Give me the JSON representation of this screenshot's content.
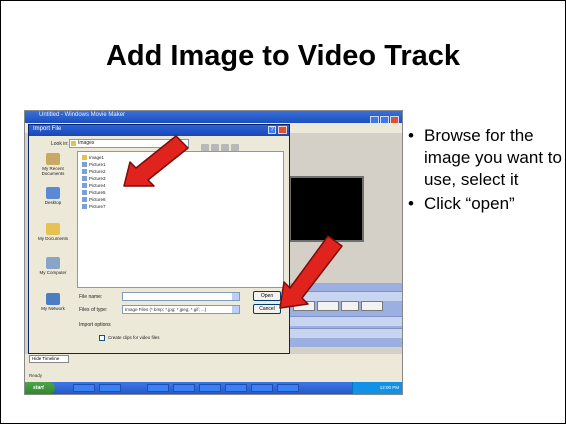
{
  "slide": {
    "title": "Add Image to Video Track",
    "bullets": [
      "Browse for the image you want to use, select it",
      "Click “open”"
    ],
    "bullet_char": "•",
    "arrow_color": "#e0231c"
  },
  "screenshot": {
    "window_title": "Untitled - Windows Movie Maker",
    "dialog": {
      "title": "Import File",
      "help_label": "?",
      "look_in_label": "Look in:",
      "look_in_value": "Images",
      "places": [
        "My Recent Documents",
        "Desktop",
        "My Documents",
        "My Computer",
        "My Network"
      ],
      "files": [
        "Image1",
        "Picture1",
        "Picture2",
        "Picture3",
        "Picture4",
        "Picture5",
        "Picture6",
        "Picture7"
      ],
      "file_name_label": "File name:",
      "file_name_value": "",
      "file_type_label": "Files of type:",
      "file_type_value": "Image Files (*.bmp; *.jpg; *.jpeg; *.gif; ...)",
      "open_label": "Open",
      "cancel_label": "Cancel",
      "import_options_label": "Import options",
      "checkbox_label": "Create clips for video files"
    },
    "bottom_tab_label": "Hide Timeline",
    "status_text": "Ready",
    "start_label": "start",
    "tray_time": "12:00 PM"
  }
}
